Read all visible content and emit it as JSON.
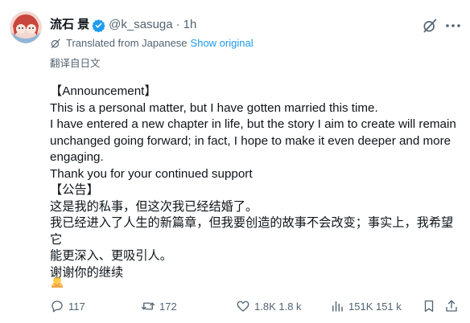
{
  "author": {
    "display_name": "流石 景",
    "handle": "@k_sasuga",
    "separator": "·",
    "time": "1h"
  },
  "translation": {
    "label": "Translated from Japanese",
    "show_original": "Show original",
    "translate_link": "翻译自日文"
  },
  "body": {
    "lines": [
      "【Announcement】",
      "This is a personal matter, but I have gotten married this time.",
      "I have entered a new chapter in life, but the story I aim to create will remain",
      "unchanged going forward; in fact, I hope to make it even deeper and more",
      "engaging.",
      "Thank you for your continued support",
      "【公告】",
      "这是我的私事，但这次我已经结婚了。",
      "我已经进入了人生的新篇章，但我要创造的故事不会改变；事实上，我希望它",
      "能更深入、更吸引人。",
      "谢谢你的继续"
    ]
  },
  "actions": {
    "replies": "117",
    "retweets": "172",
    "likes": "1.8K 1.8 k",
    "views": "151K 151 k"
  },
  "icons": {
    "verified": "verified-badge-icon",
    "grok": "grok-icon",
    "more": "more-icon",
    "translate": "translate-icon",
    "emoji": "bowing-person-emoji",
    "reply": "reply-icon",
    "retweet": "retweet-icon",
    "like": "heart-icon",
    "views": "views-icon",
    "bookmark": "bookmark-icon",
    "share": "share-icon"
  },
  "colors": {
    "text": "#0f1419",
    "muted": "#536471",
    "link": "#1d9bf0",
    "verified": "#1d9bf0"
  }
}
